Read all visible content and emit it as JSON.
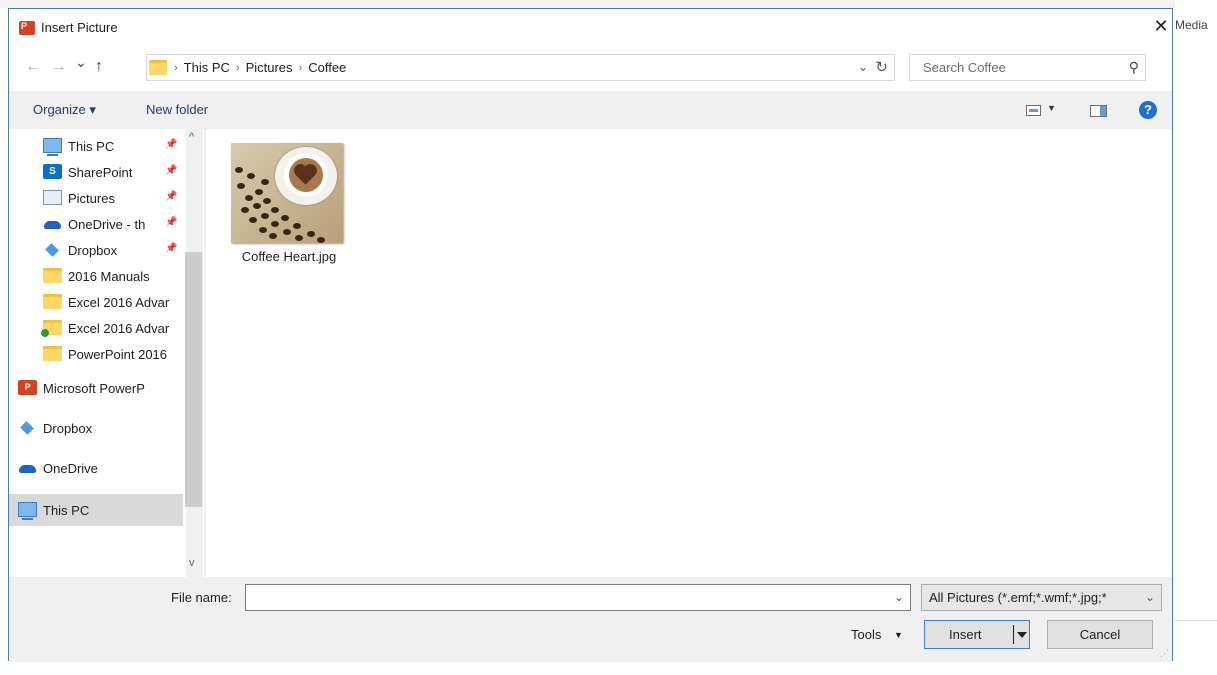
{
  "background": {
    "right_label": "Media"
  },
  "dialog": {
    "title": "Insert Picture",
    "app_icon_text": "P",
    "close_symbol": "✕"
  },
  "nav": {
    "back_symbol": "←",
    "forward_symbol": "→",
    "recent_symbol": "⌄",
    "up_symbol": "↑",
    "breadcrumbs": [
      "This PC",
      "Pictures",
      "Coffee"
    ],
    "separator": "›",
    "dropdown_symbol": "⌄",
    "refresh_symbol": "↻"
  },
  "search": {
    "placeholder": "Search Coffee",
    "icon_symbol": "⚲"
  },
  "toolbar": {
    "organize_label": "Organize ▾",
    "new_folder_label": "New folder",
    "view_dropdown_symbol": "▼",
    "help_symbol": "?"
  },
  "sidebar": {
    "items": [
      {
        "label": "This PC",
        "icon": "pc-icon",
        "pinned": true
      },
      {
        "label": "SharePoint",
        "icon": "sharepoint-icon",
        "pinned": true
      },
      {
        "label": "Pictures",
        "icon": "pictures-icon",
        "pinned": true
      },
      {
        "label": "OneDrive - th",
        "icon": "onedrive-icon",
        "pinned": true
      },
      {
        "label": "Dropbox",
        "icon": "dropbox-icon",
        "pinned": true
      },
      {
        "label": "2016 Manuals",
        "icon": "folder-icon"
      },
      {
        "label": "Excel 2016 Advar",
        "icon": "folder-icon"
      },
      {
        "label": "Excel 2016 Advar",
        "icon": "folder-synced-icon"
      },
      {
        "label": "PowerPoint 2016",
        "icon": "folder-icon"
      },
      {
        "label": "Microsoft PowerP",
        "icon": "powerpoint-icon"
      },
      {
        "label": "Dropbox",
        "icon": "dropbox-icon"
      },
      {
        "label": "OneDrive",
        "icon": "onedrive-icon"
      },
      {
        "label": "This PC",
        "icon": "pc-icon",
        "selected": true
      }
    ],
    "pin_symbol": "📌",
    "scroll_up": "^",
    "scroll_down": "v"
  },
  "files": [
    {
      "name": "Coffee Heart.jpg",
      "type": "image"
    }
  ],
  "bottom": {
    "file_name_label": "File name:",
    "file_name_value": "",
    "file_type": "All Pictures (*.emf;*.wmf;*.jpg;*",
    "tools_label": "Tools",
    "insert_label": "Insert",
    "cancel_label": "Cancel",
    "dropdown_symbol": "⌄",
    "tools_dropdown_symbol": "▼"
  },
  "colors": {
    "accent": "#1f6fd1",
    "selection": "#cce4f7",
    "folder": "#ffd667",
    "powerpoint": "#d04423"
  }
}
